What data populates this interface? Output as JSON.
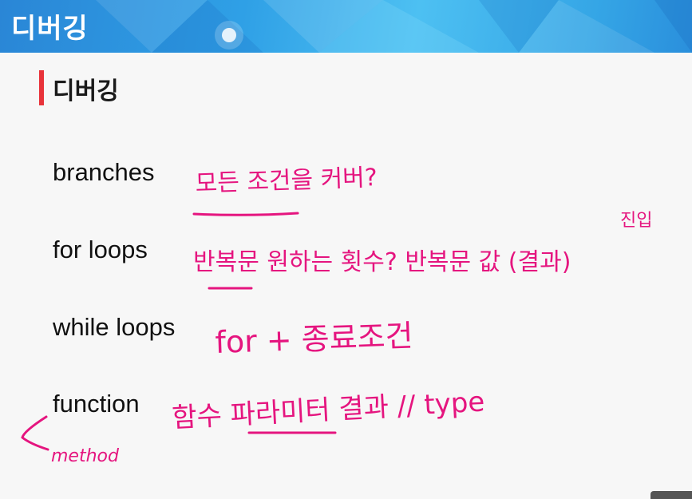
{
  "header": {
    "title": "디버깅"
  },
  "section": {
    "title": "디버깅"
  },
  "items": [
    {
      "label": "branches"
    },
    {
      "label": "for loops"
    },
    {
      "label": "while loops"
    },
    {
      "label": "function"
    }
  ],
  "annotations": {
    "ink_color": "#e5157f",
    "branches_note": "모든 조건을 커버?",
    "for_loops_note": "반복문 원하는 횟수? 반복문 값 (결과)",
    "for_loops_superscript": "진입",
    "while_loops_note": "for + 종료조건",
    "function_note": "함수 파라미터 결과 // type",
    "method_note": "method"
  },
  "colors": {
    "header_blue": "#2fa0e6",
    "accent_red": "#e8333a"
  }
}
